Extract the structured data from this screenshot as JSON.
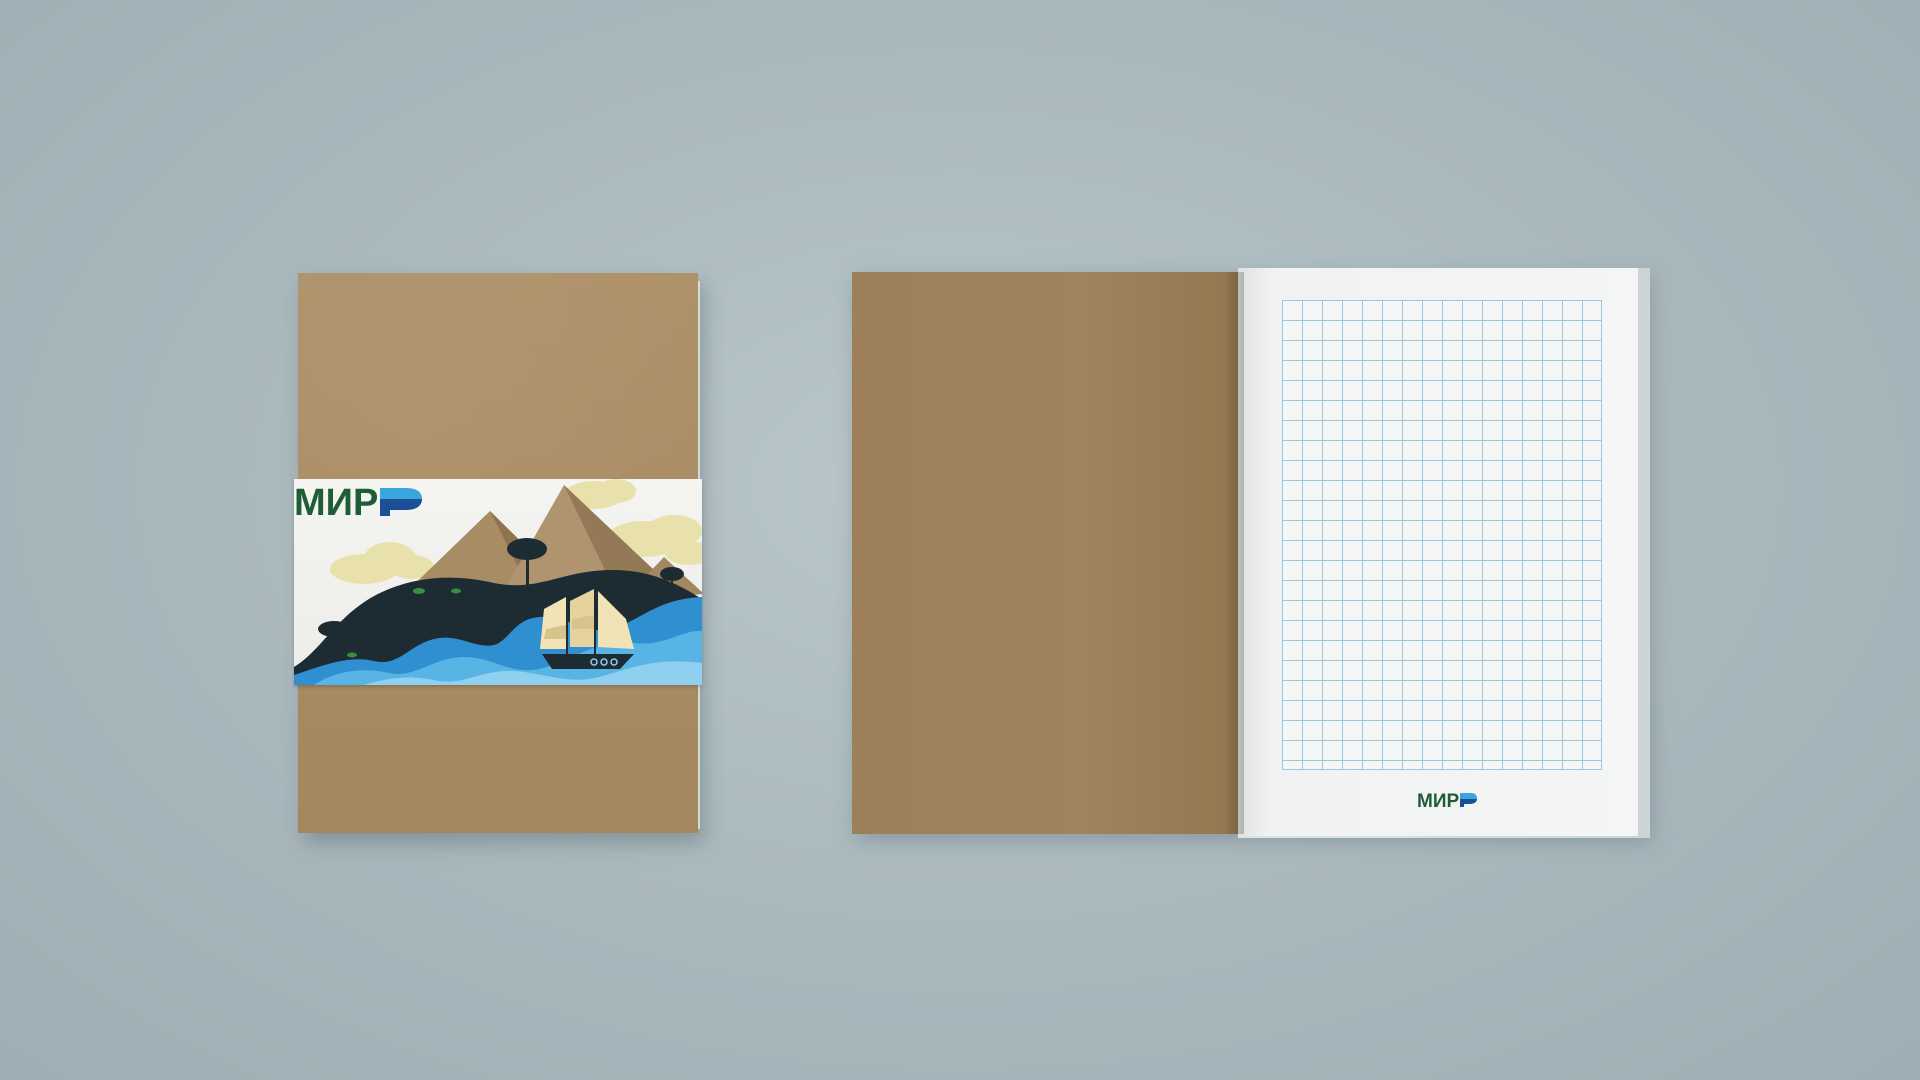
{
  "scene": {
    "description_colors": {
      "background": "#aebdc1",
      "kraft_cover": "#a98c64",
      "grid_line": "#9fc6de",
      "logo_green": "#1f5d36",
      "logo_blue_dark": "#1b4f96",
      "logo_blue_light": "#3aa6dd"
    }
  },
  "closed_notebook": {
    "band": {
      "logo_text": "МИР"
    }
  },
  "open_notebook": {
    "page": {
      "logo_text": "МИР"
    }
  }
}
